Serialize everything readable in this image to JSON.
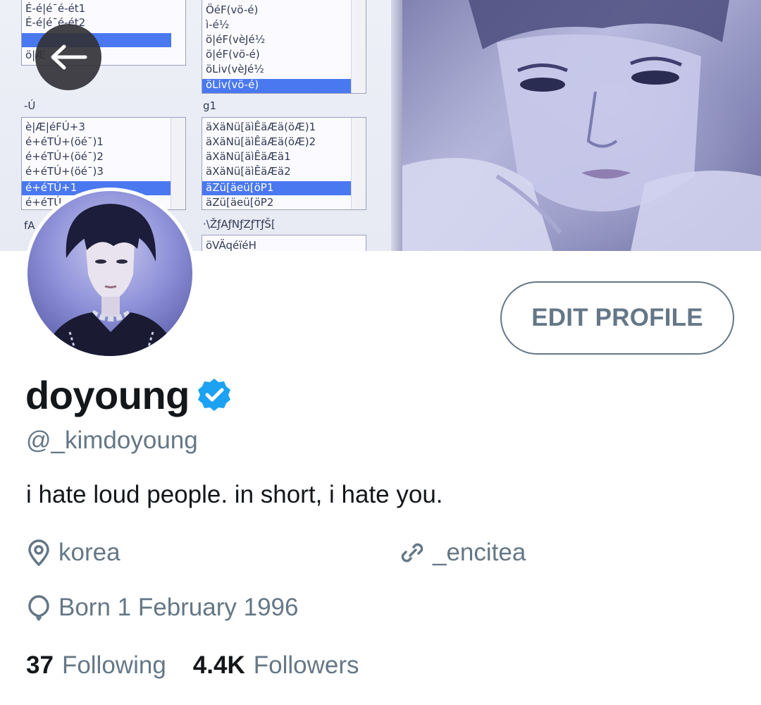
{
  "header": {
    "back_icon": "arrow-left-icon",
    "banner_text": {
      "col1_top": [
        "É-é|é¯é-ét1",
        "É-é|é¯é-ét2",
        "ö|Æ"
      ],
      "col1_label": "-Ú",
      "col1_list": [
        "è|Æ|éFÚ+3",
        "é+éTÚ+(öé¯)1",
        "é+éTÚ+(öé¯)2",
        "é+éTÚ+(öé¯)3",
        "é+éTÚ+1",
        "é+éTÚ"
      ],
      "col1_bottom": "fA",
      "col2_top": [
        "ÖéF(vö-é)",
        "ì-é½",
        "ö|éF(vèJé½",
        "ö|éF(vö-é)",
        "öLiv(vèJé½",
        "öLiv(vö-é)"
      ],
      "col2_label": "g1",
      "col2_list": [
        "äXäNü[äìÊäÆä(öÆ)1",
        "äXäNü[äìÊäÆä(öÆ)2",
        "äXäNü[äìÊäÆä1",
        "äXäNü[äìÊäÆä2",
        "äZü[äeü[öP1",
        "äZü[äeü[öP2"
      ],
      "col2_bottom": "·\\ŽƒAƒNƒZƒTƒŠ[",
      "col2_field": "öVÄqéïéH"
    }
  },
  "profile": {
    "edit_button_label": "EDIT PROFILE",
    "display_name": "doyoung",
    "verified_icon": "verified-badge-icon",
    "handle": "@_kimdoyoung",
    "bio": "i hate loud people. in short, i hate you.",
    "location": "korea",
    "website": "_encitea",
    "birthday": "Born 1 February 1996",
    "following_count": "37",
    "following_label": "Following",
    "followers_count": "4.4K",
    "followers_label": "Followers",
    "colors": {
      "accent": "#1da1f2",
      "secondary_text": "#657786",
      "primary_text": "#14171a"
    }
  }
}
